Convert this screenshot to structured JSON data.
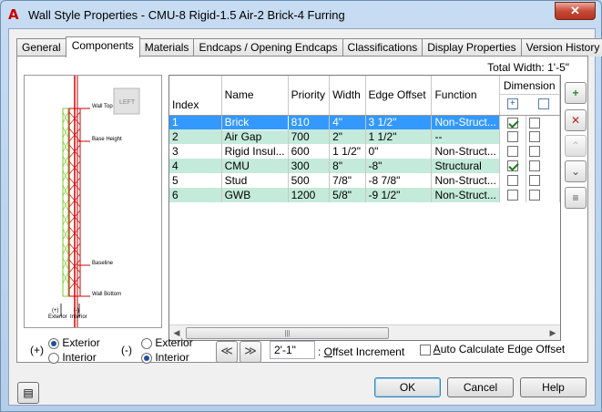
{
  "window": {
    "title": "Wall Style Properties - CMU-8 Rigid-1.5 Air-2 Brick-4 Furring",
    "close_label": "✕"
  },
  "tabs": [
    {
      "label": "General"
    },
    {
      "label": "Components"
    },
    {
      "label": "Materials"
    },
    {
      "label": "Endcaps / Opening Endcaps"
    },
    {
      "label": "Classifications"
    },
    {
      "label": "Display Properties"
    },
    {
      "label": "Version History"
    }
  ],
  "active_tab": "Components",
  "total_width": "Total Width: 1'-5\"",
  "preview": {
    "viewcube_label": "LEFT",
    "labels": {
      "wall_top": "Wall Top",
      "base_height": "Base Height",
      "baseline": "Baseline",
      "wall_bottom": "Wall Bottom",
      "exterior_sign": "(+)",
      "exterior": "Exterior",
      "interior_sign": "(-)",
      "interior": "Interior"
    }
  },
  "grid": {
    "dimension_header": "Dimension",
    "columns": [
      "Index",
      "Name",
      "Priority",
      "Width",
      "Edge Offset",
      "Function"
    ],
    "rows": [
      {
        "index": "1",
        "name": "Brick",
        "priority": "810",
        "width": "4\"",
        "edge_offset": "3 1/2\"",
        "function": "Non-Struct...",
        "dim": true
      },
      {
        "index": "2",
        "name": "Air Gap",
        "priority": "700",
        "width": "2\"",
        "edge_offset": "1 1/2\"",
        "function": "--",
        "dim": false
      },
      {
        "index": "3",
        "name": "Rigid Insul...",
        "priority": "600",
        "width": "1 1/2\"",
        "edge_offset": "0\"",
        "function": "Non-Struct...",
        "dim": false
      },
      {
        "index": "4",
        "name": "CMU",
        "priority": "300",
        "width": "8\"",
        "edge_offset": "-8\"",
        "function": "Structural",
        "dim": true
      },
      {
        "index": "5",
        "name": "Stud",
        "priority": "500",
        "width": "7/8\"",
        "edge_offset": "-8 7/8\"",
        "function": "Non-Struct...",
        "dim": false
      },
      {
        "index": "6",
        "name": "GWB",
        "priority": "1200",
        "width": "5/8\"",
        "edge_offset": "-9 1/2\"",
        "function": "Non-Struct...",
        "dim": false
      }
    ],
    "selected_row": 0,
    "scroll_thumb_glyph": "|||"
  },
  "side_buttons": [
    {
      "name": "add-component-button",
      "glyph": "+",
      "enabled": true
    },
    {
      "name": "remove-component-button",
      "glyph": "✕",
      "enabled": true
    },
    {
      "name": "move-up-button",
      "glyph": "⌃",
      "enabled": false
    },
    {
      "name": "move-down-button",
      "glyph": "⌄",
      "enabled": true
    },
    {
      "name": "component-details-button",
      "glyph": "≡",
      "enabled": true
    }
  ],
  "options": {
    "plus_sign": "(+)",
    "minus_sign": "(-)",
    "exterior": "Exterior",
    "interior": "Interior",
    "plus_selected": "Exterior",
    "minus_selected": "Interior",
    "offset_value": "2'-1\"",
    "offset_label_prefix": ": ",
    "offset_label_u": "O",
    "offset_label_rest": "ffset Increment",
    "auto_calc_u": "A",
    "auto_calc_rest": "uto Calculate Edge Offset",
    "auto_calc_checked": false,
    "nav_left": "≪",
    "nav_right": "≫"
  },
  "footer": {
    "ok": "OK",
    "cancel": "Cancel",
    "help": "Help",
    "style_browser_glyph": "▤"
  }
}
